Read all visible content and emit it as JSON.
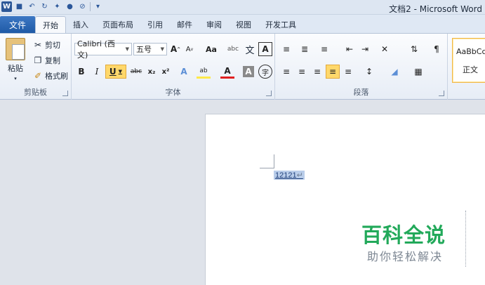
{
  "window": {
    "title": "文档2 - Microsoft Word"
  },
  "qat": {
    "logo": "W"
  },
  "tabs": [
    {
      "label": "文件"
    },
    {
      "label": "开始"
    },
    {
      "label": "插入"
    },
    {
      "label": "页面布局"
    },
    {
      "label": "引用"
    },
    {
      "label": "邮件"
    },
    {
      "label": "审阅"
    },
    {
      "label": "视图"
    },
    {
      "label": "开发工具"
    }
  ],
  "clipboard": {
    "paste": "粘贴",
    "cut": "剪切",
    "copy": "复制",
    "format_painter": "格式刷",
    "label": "剪贴板"
  },
  "font": {
    "name": "Calibri (西文)",
    "size": "五号",
    "grow": "A",
    "shrink": "A",
    "case": "Aa",
    "clear": "abc",
    "wen": "文",
    "charbox": "A",
    "bold": "B",
    "italic": "I",
    "underline": "U",
    "strike": "abc",
    "subscript": "x₂",
    "superscript": "x²",
    "effects": "A",
    "highlight": "ab",
    "color": "A",
    "shade": "A",
    "enclose": "字",
    "label": "字体"
  },
  "paragraph": {
    "label": "段落"
  },
  "styles": {
    "sample": "AaBbCcI",
    "normal": "正文"
  },
  "document": {
    "text": "12121",
    "para_mark": "↵"
  },
  "watermark": {
    "title": "百科全说",
    "subtitle": "助你轻松解决"
  },
  "colors": {
    "file_tab": "#2b5797",
    "highlight": "#ffd86b",
    "watermark": "#22a95a"
  }
}
